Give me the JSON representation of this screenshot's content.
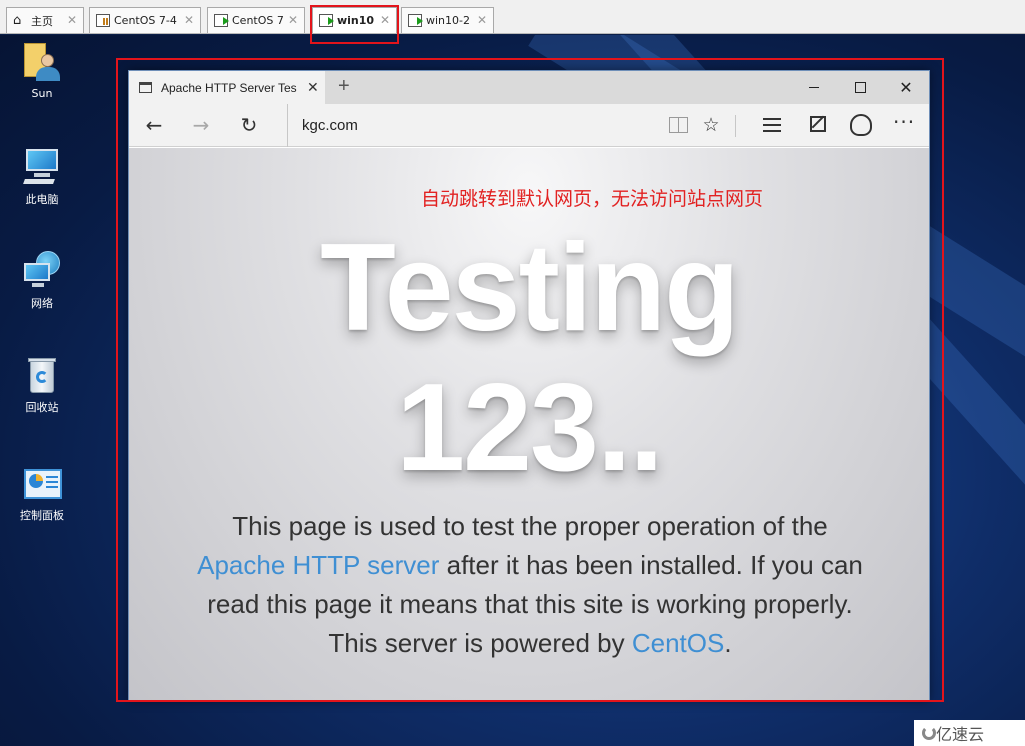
{
  "vm_tabs": [
    {
      "label": "主页",
      "icon": "home-icon"
    },
    {
      "label": "CentOS 7-4",
      "icon": "vm-icon"
    },
    {
      "label": "CentOS 7",
      "icon": "vm-running-icon"
    },
    {
      "label": "win10",
      "icon": "vm-running-icon",
      "active": true
    },
    {
      "label": "win10-2",
      "icon": "vm-running-icon"
    }
  ],
  "desktop_icons": [
    {
      "label": "Sun",
      "icon": "user-folder-icon"
    },
    {
      "label": "此电脑",
      "icon": "this-pc-icon"
    },
    {
      "label": "网络",
      "icon": "network-icon"
    },
    {
      "label": "回收站",
      "icon": "recycle-bin-icon"
    },
    {
      "label": "控制面板",
      "icon": "control-panel-icon"
    }
  ],
  "browser": {
    "tab_title": "Apache HTTP Server Tes",
    "new_tab": "+",
    "address": "kgc.com",
    "icons": [
      "back-icon",
      "forward-icon",
      "refresh-icon",
      "reading-view-icon",
      "favorite-star-icon",
      "hub-icon",
      "web-note-icon",
      "share-icon",
      "more-icon"
    ]
  },
  "page": {
    "annotation": "自动跳转到默认网页，无法访问站点网页",
    "heading_line1": "Testing",
    "heading_line2": "123..",
    "text_1": "This page is used to test the proper operation of the ",
    "link_apache": "Apache HTTP server",
    "text_2": " after it has been installed. If you can read this page it means that this site is working properly. This server is powered by ",
    "link_centos": "CentOS",
    "text_3": "."
  },
  "watermark": "亿速云",
  "colors": {
    "annotation_red": "#e3141b",
    "link_blue": "#3f8fd3",
    "desktop_blue": "#0f2d68"
  }
}
